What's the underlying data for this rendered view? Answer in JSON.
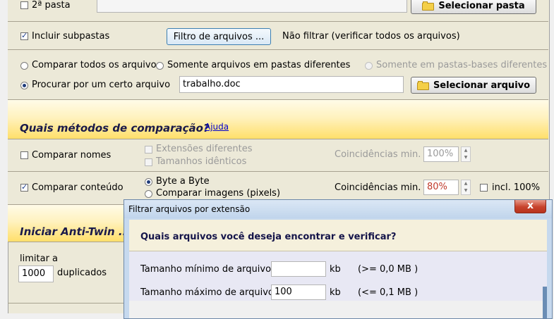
{
  "second_folder": {
    "label": "2ª pasta",
    "button": "Selecionar pasta",
    "path": ""
  },
  "include_subfolders": {
    "label": "Incluir subpastas",
    "checked": true,
    "filter_button": "Filtro de arquivos ...",
    "filter_status": "Não filtrar (verificar todos os arquivos)"
  },
  "search_mode": {
    "compare_all": "Comparar todos os arquivo",
    "only_different_folders": "Somente arquivos em pastas diferentes",
    "only_different_base": "Somente em pastas-bases diferentes",
    "search_certain": "Procurar por um certo arquivo",
    "file_value": "trabalho.doc",
    "select_file_button": "Selecionar arquivo"
  },
  "methods_header": {
    "title": "Quais métodos de comparação?",
    "help_link": "Ajuda"
  },
  "compare_names": {
    "label": "Comparar nomes",
    "different_extensions": "Extensões diferentes",
    "identical_sizes": "Tamanhos idênticos",
    "min_matches_label": "Coincidências min.",
    "min_matches_value": "100%"
  },
  "compare_content": {
    "label": "Comparar conteúdo",
    "byte_by_byte": "Byte a Byte",
    "compare_images": "Comparar imagens (pixels)",
    "min_matches_label": "Coincidências min.",
    "min_matches_value": "80%",
    "incl_label": "incl. 100%"
  },
  "start": {
    "title": "Iniciar Anti-Twin ...",
    "limit_label": "limitar a",
    "limit_value": "1000",
    "duplicates_label": "duplicados"
  },
  "dialog": {
    "title": "Filtrar arquivos por extensão",
    "close": "x",
    "question": "Quais arquivos você deseja encontrar e verificar?",
    "min_size_label": "Tamanho mínimo de arquivo",
    "min_size_value": "",
    "min_unit": "kb",
    "min_note": "(>= 0,0 MB )",
    "max_size_label": "Tamanho máximo de arquivo",
    "max_size_value": "100",
    "max_unit": "kb",
    "max_note": "(<= 0,1 MB )"
  }
}
